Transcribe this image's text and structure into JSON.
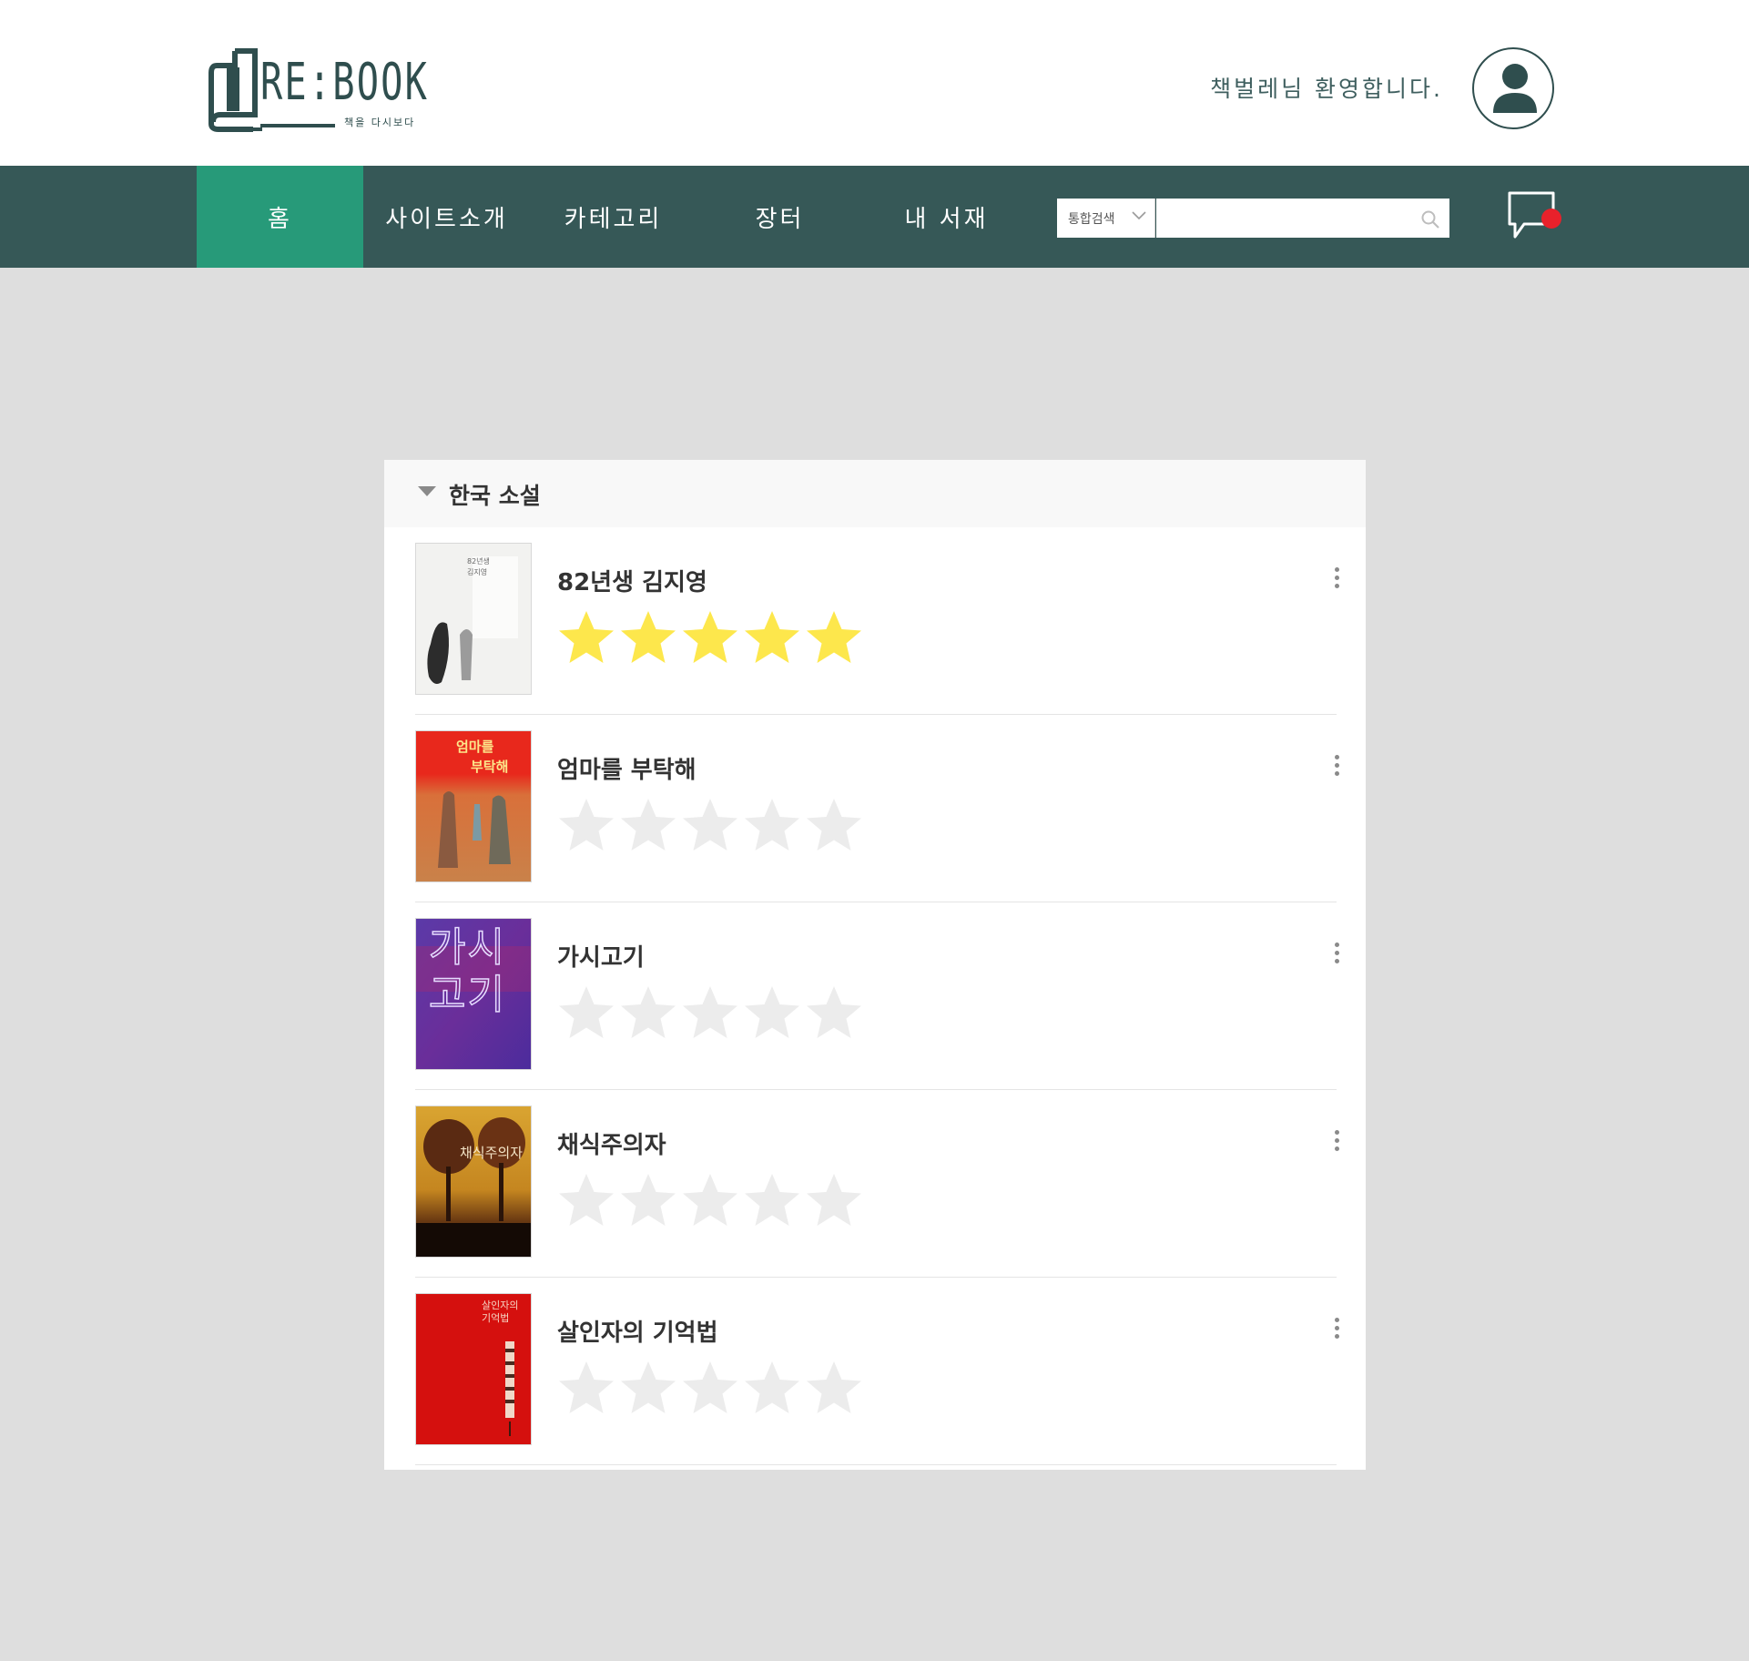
{
  "brand": {
    "logo_text": "RE:BOOK",
    "tagline": "책을 다시보다",
    "primary_color": "#365857",
    "active_color": "#279a79"
  },
  "header": {
    "welcome_text": "책벌레님 환영합니다.",
    "avatar_icon": "user-icon"
  },
  "nav": {
    "items": [
      {
        "label": "홈",
        "active": true
      },
      {
        "label": "사이트소개",
        "active": false
      },
      {
        "label": "카테고리",
        "active": false
      },
      {
        "label": "장터",
        "active": false
      },
      {
        "label": "내 서재",
        "active": false
      }
    ],
    "search": {
      "scope_selected": "통합검색",
      "query": "",
      "placeholder": "",
      "icon": "search-icon"
    },
    "chat": {
      "icon": "chat-bubble-icon",
      "has_notification": true,
      "notification_color": "#e8212b"
    }
  },
  "panel": {
    "title": "한국 소설",
    "collapse_icon": "caret-down-icon",
    "books": [
      {
        "title": "82년생 김지영",
        "rating": 5,
        "cover_text": [
          "82년생",
          "김지영"
        ]
      },
      {
        "title": "엄마를 부탁해",
        "rating": 0,
        "cover_text": [
          "엄마를",
          "부탁해"
        ]
      },
      {
        "title": "가시고기",
        "rating": 0,
        "cover_text": [
          "가시",
          "고기"
        ]
      },
      {
        "title": "채식주의자",
        "rating": 0,
        "cover_text": [
          "채식주의자"
        ]
      },
      {
        "title": "살인자의 기억법",
        "rating": 0,
        "cover_text": [
          "살인자의",
          "기억법"
        ]
      }
    ],
    "max_rating": 5,
    "star_filled_color": "#fde74c",
    "star_empty_color": "#ececec"
  }
}
